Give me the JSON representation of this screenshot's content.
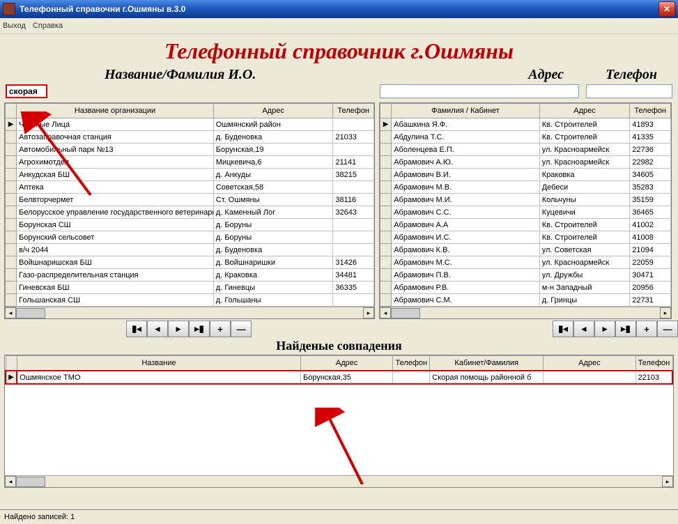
{
  "window": {
    "title": "Телефонный справочни г.Ошмяны в.3.0"
  },
  "menu": {
    "exit": "Выход",
    "help": "Справка"
  },
  "heading": "Телефонный справочник г.Ошмяны",
  "labels": {
    "name": "Название/Фамилия И.О.",
    "addr": "Адрес",
    "phone": "Телефон",
    "matches": "Найденые совпадения"
  },
  "search": {
    "name_value": "скорая",
    "addr_value": "",
    "phone_value": ""
  },
  "left_grid": {
    "headers": [
      "Название организации",
      "Адрес",
      "Телефон"
    ],
    "rows": [
      [
        "Частные Лица",
        "Ошмянский район",
        ""
      ],
      [
        "Автозаправочная станция",
        "д. Буденовка",
        "21033"
      ],
      [
        "Автомобильный парк №13",
        "Борунская,19",
        ""
      ],
      [
        "Агрохимотдел",
        "Мицкевича,6",
        "21141"
      ],
      [
        "Анкудская БШ",
        "д. Анкуды",
        "38215"
      ],
      [
        "Аптека",
        "Советская,58",
        ""
      ],
      [
        "Белвторчермет",
        "Ст. Ошмяны",
        "38116"
      ],
      [
        "Белорусское управление государственного ветеринарн",
        "д. Каменный Лог",
        "32643"
      ],
      [
        "Борунская СШ",
        "д. Боруны",
        ""
      ],
      [
        "Борунский сельсовет",
        "д. Боруны",
        ""
      ],
      [
        "в/ч 2044",
        "д. Буденовка",
        ""
      ],
      [
        "Войшнаришская БШ",
        "д. Войшнаришки",
        "31426"
      ],
      [
        "Газо-распределительная станция",
        "д. Краковка",
        "34481"
      ],
      [
        "Гиневская БШ",
        "д. Гиневцы",
        "36335"
      ],
      [
        "Гольшанская СШ",
        "д. Гольшаны",
        ""
      ]
    ]
  },
  "right_grid": {
    "headers": [
      "Фамилия / Кабинет",
      "Адрес",
      "Телефон"
    ],
    "rows": [
      [
        "Абашкина Я.Ф.",
        "Кв. Строителей",
        "41893"
      ],
      [
        "Абдулина Т.С.",
        "Кв. Строителей",
        "41335"
      ],
      [
        "Аболенцева Е.П.",
        "ул. Красноармейск",
        "22736"
      ],
      [
        "Абрамович  А.Ю.",
        "ул. Красноармейск",
        "22982"
      ],
      [
        "Абрамович  В.И.",
        "Краковка",
        "34605"
      ],
      [
        "Абрамович  М.В.",
        "Дебеси",
        "35283"
      ],
      [
        "Абрамович  М.И.",
        "Кольчуны",
        "35159"
      ],
      [
        "Абрамович  С.С.",
        "Куцевичи",
        "36465"
      ],
      [
        "Абрамович А.А",
        "Кв. Строителей",
        "41002"
      ],
      [
        "Абрамович И.С.",
        "Кв. Строителей",
        "41008"
      ],
      [
        "Абрамович К.В.",
        "ул. Советская",
        "21094"
      ],
      [
        "Абрамович М.С.",
        "ул. Красноармейск",
        "22059"
      ],
      [
        "Абрамович П.В.",
        "ул. Дружбы",
        "30471"
      ],
      [
        "Абрамович Р.В.",
        "м-н Западный",
        "20956"
      ],
      [
        "Абрамович С.М.",
        "д. Гринцы",
        "22731"
      ]
    ]
  },
  "match_grid": {
    "headers": [
      "Название",
      "Адрес",
      "Телефон",
      "Кабинет/Фамилия",
      "Адрес",
      "Телефон"
    ],
    "rows": [
      [
        "Ошмянское ТМО",
        "Борунская,35",
        "",
        "Скорая помощь районной б",
        "",
        "22103"
      ]
    ]
  },
  "nav": {
    "first": "▏◂",
    "prev": "◂",
    "next": "▸",
    "last": "▸▏",
    "add": "+",
    "del": "—"
  },
  "status": "Найдено записей: 1"
}
